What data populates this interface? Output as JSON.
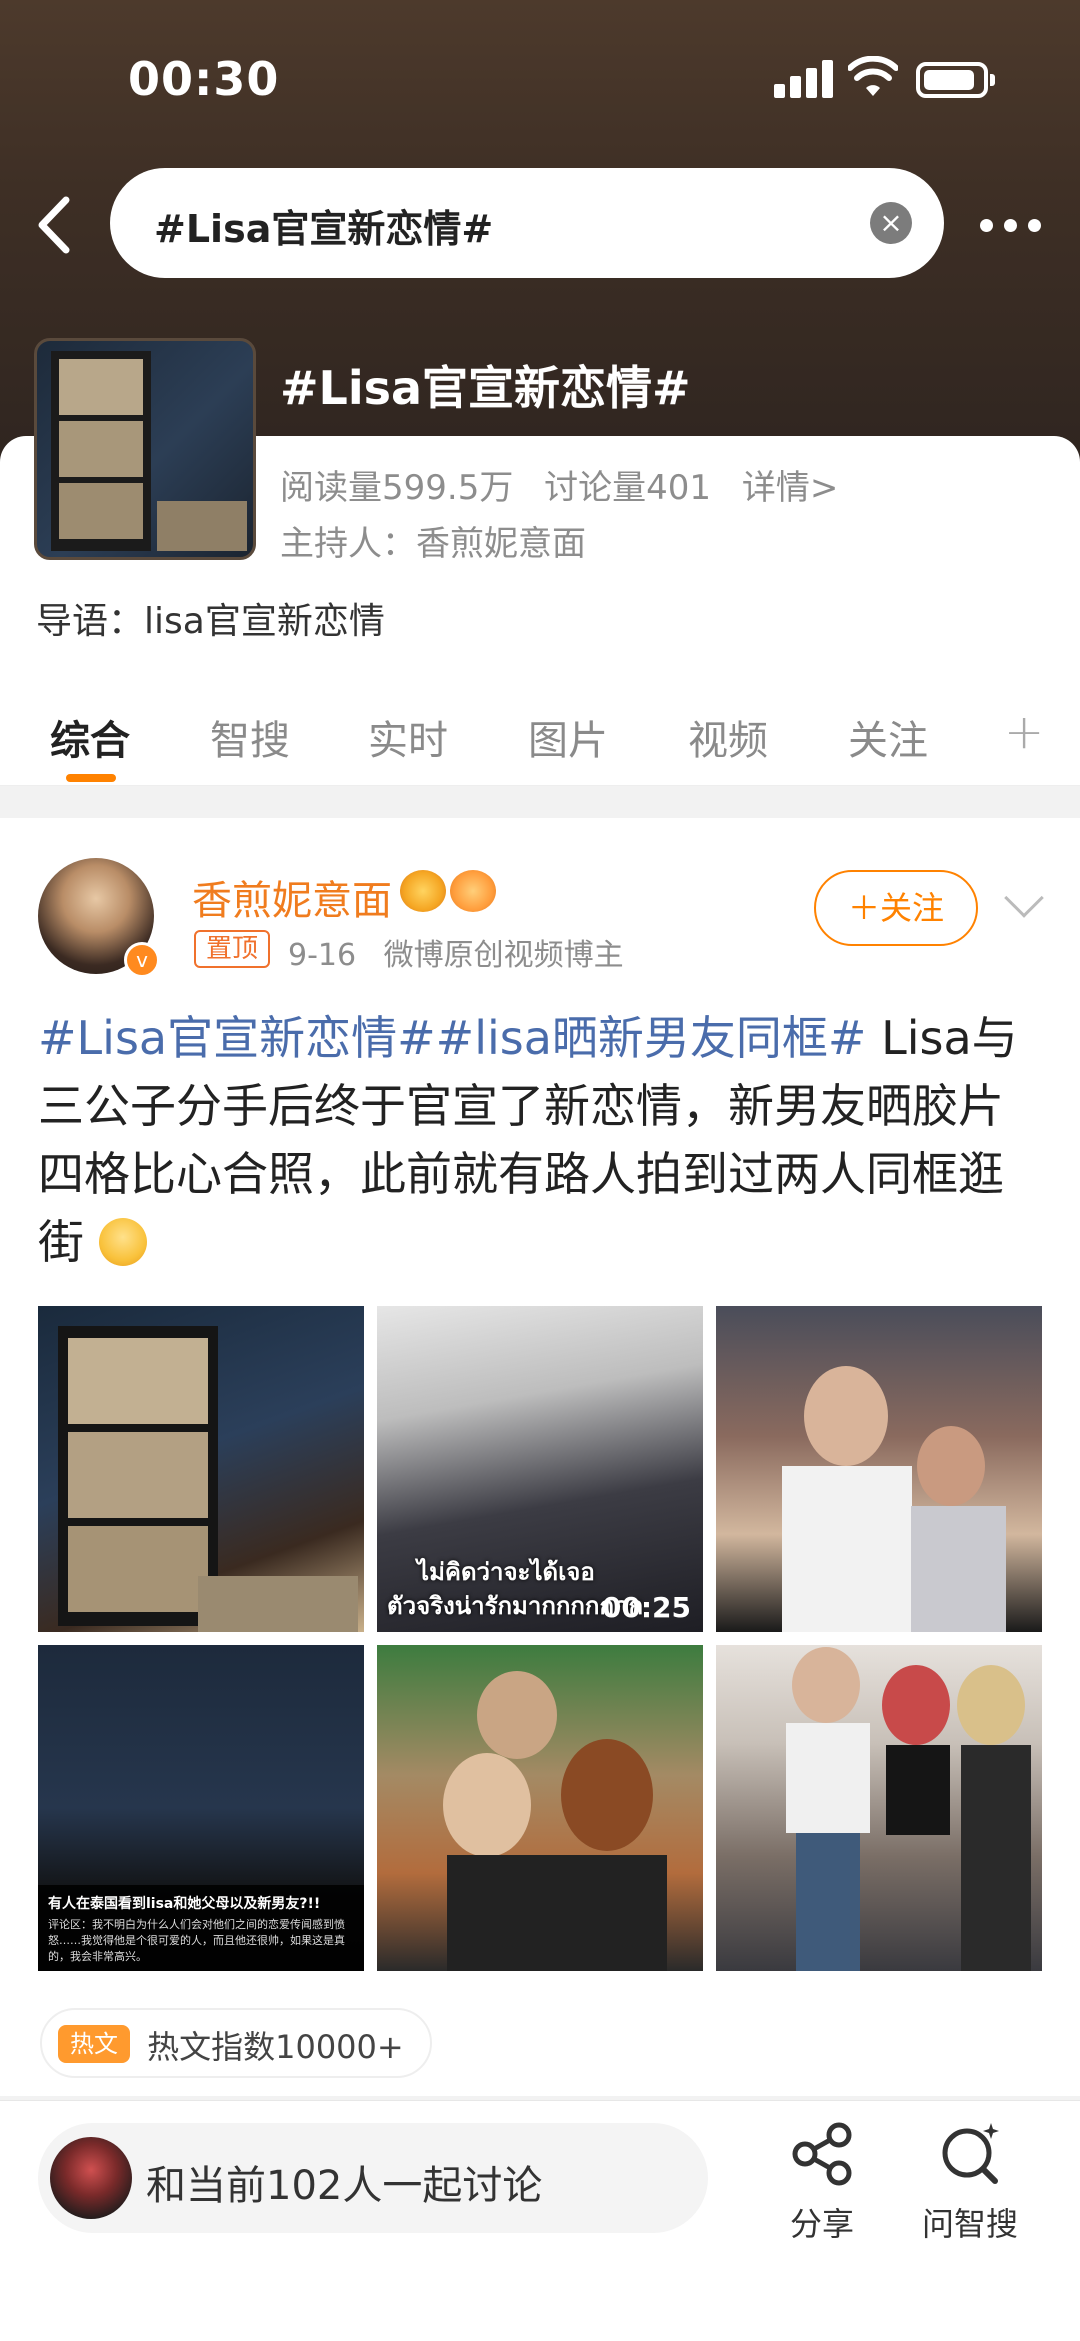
{
  "status_bar": {
    "time": "00:30"
  },
  "search": {
    "query": "#Lisa官宣新恋情#"
  },
  "topic": {
    "title": "#Lisa官宣新恋情#",
    "reads": "阅读量599.5万",
    "discussions": "讨论量401",
    "details": "详情>",
    "host": "主持人：香煎妮意面",
    "intro": "导语：lisa官宣新恋情"
  },
  "tabs": [
    "综合",
    "智搜",
    "实时",
    "图片",
    "视频",
    "关注"
  ],
  "post": {
    "username": "香煎妮意面",
    "pin": "置顶",
    "date": "9-16",
    "source": "微博原创视频博主",
    "follow": "＋关注",
    "tags": "#Lisa官宣新恋情##lisa晒新男友同框#",
    "body": " Lisa与三公子分手后终于官宣了新恋情，新男友晒胶片四格比心合照，此前就有路人拍到过两人同框逛街",
    "video_duration": "00:25",
    "thai_line1": "ไม่คิดว่าจะได้เจอ",
    "thai_line2": "ตัวจริงน่ารักมากกกกกกก",
    "caption_title": "有人在泰国看到lisa和她父母以及新男友?!!",
    "caption_body": "评论区：我不明白为什么人们会对他们之间的恋爱传闻感到愤怒……我觉得他是个很可爱的人，而且他还很帅，如果这是真的，我会非常高兴。",
    "hot_label": "热文",
    "hot_index": "热文指数10000+"
  },
  "bottom": {
    "discuss": "和当前102人一起讨论",
    "share": "分享",
    "smart_search": "问智搜"
  },
  "colors": {
    "accent": "#ff8200",
    "tag": "#4a6cab"
  }
}
